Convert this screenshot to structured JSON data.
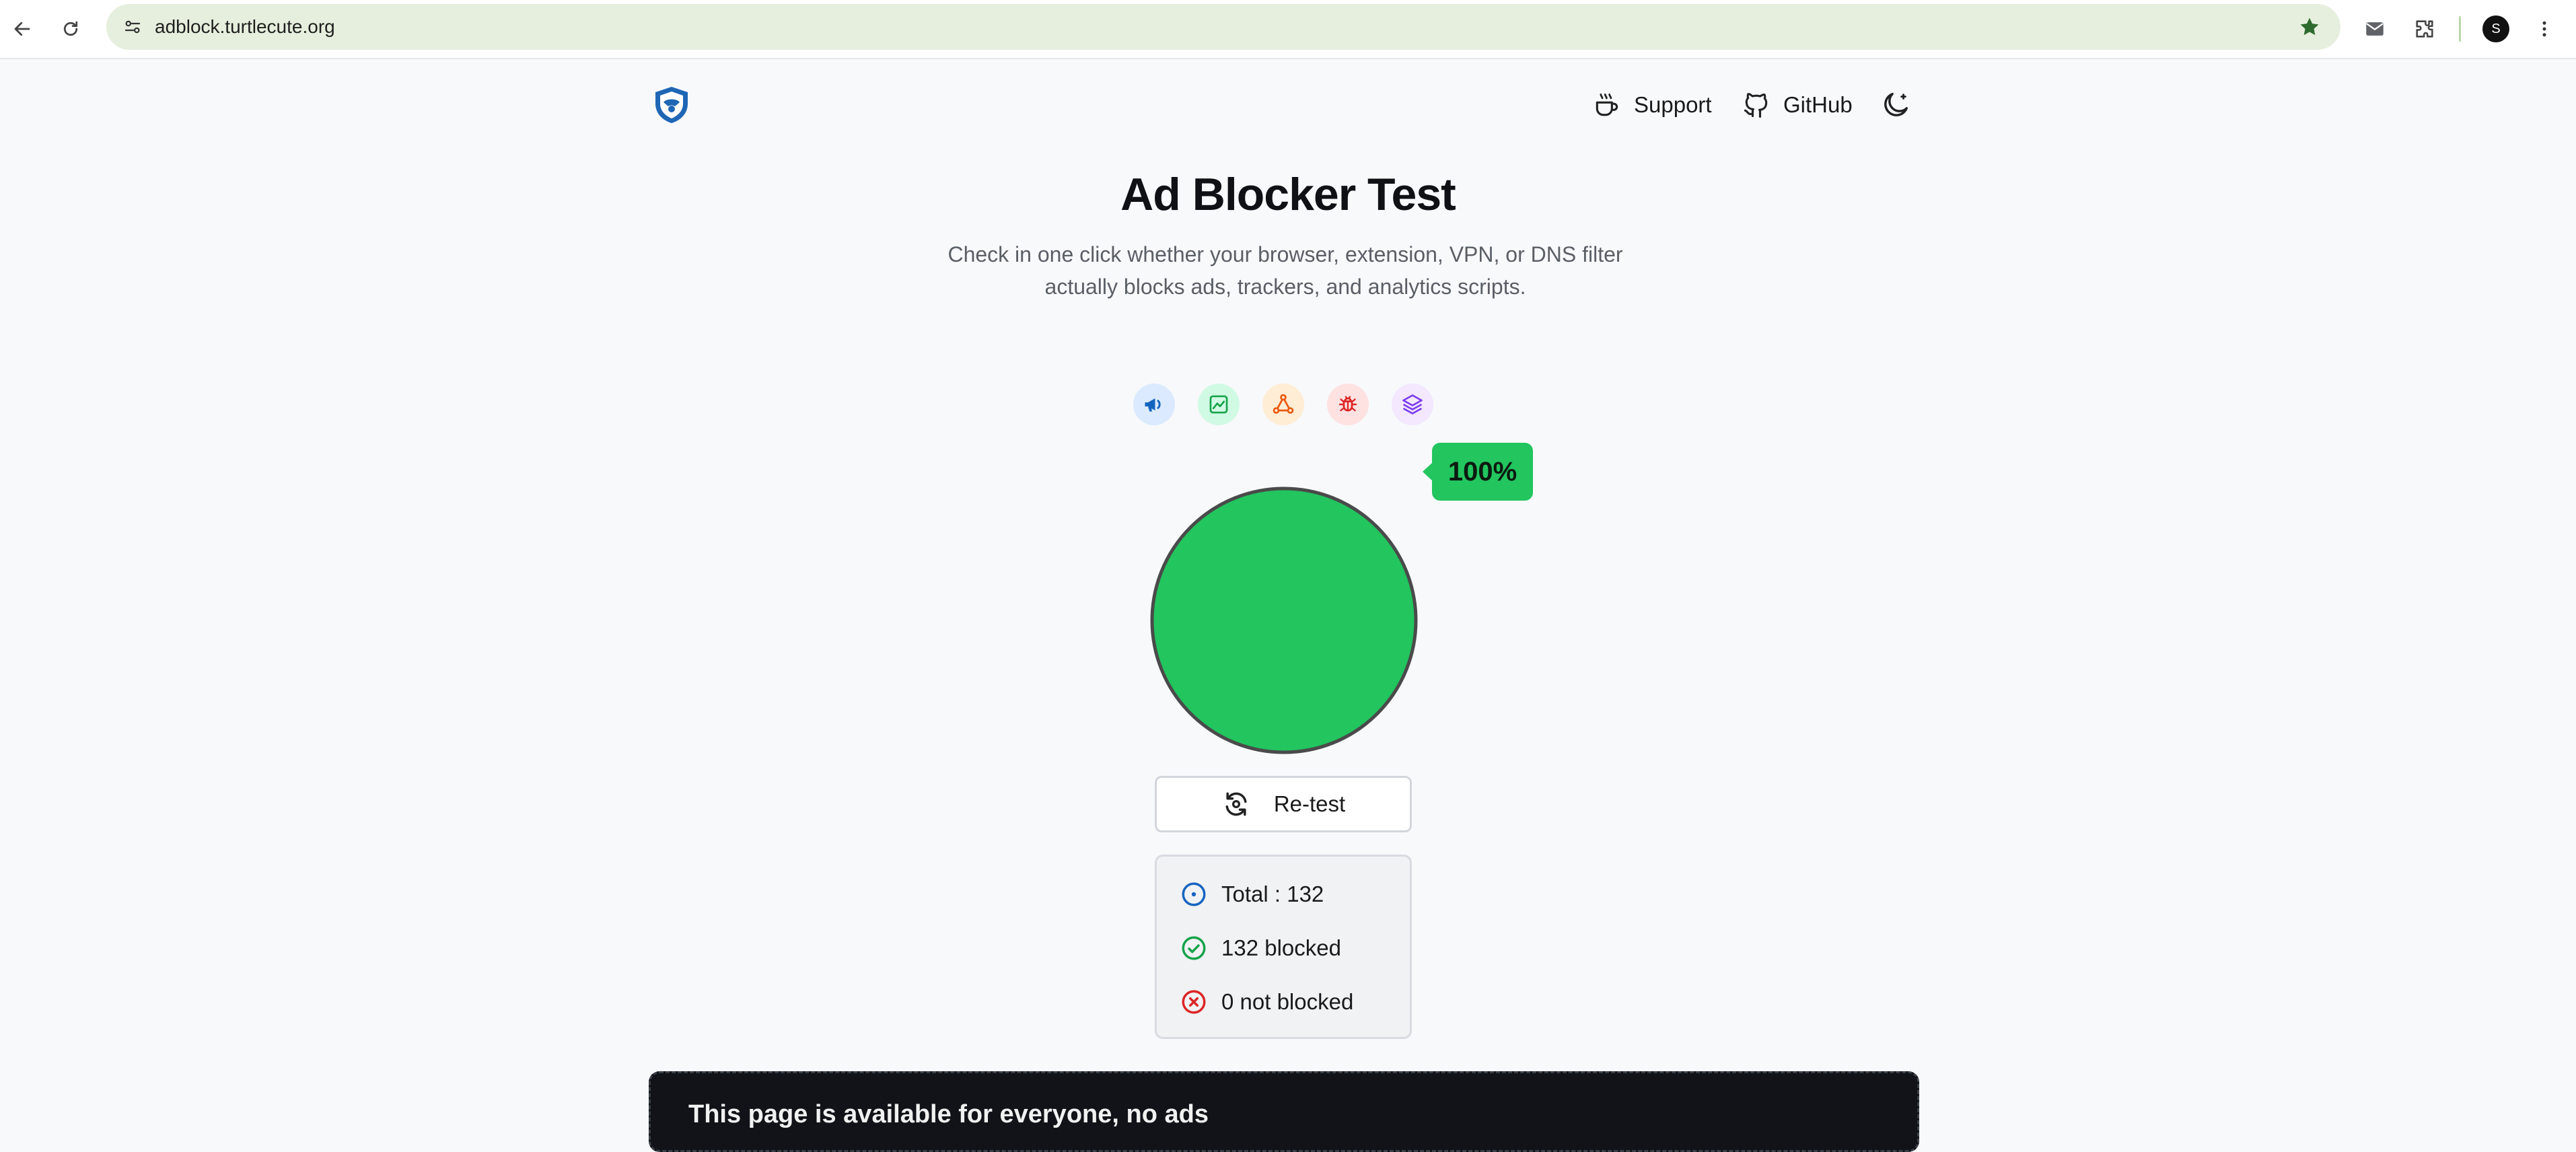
{
  "browser": {
    "url": "adblock.turtlecute.org",
    "avatar_letter": "S",
    "icons": [
      "back-icon",
      "reload-icon",
      "site-info-icon",
      "bookmark-star-icon",
      "mail-icon",
      "extensions-icon",
      "profile-avatar",
      "kebab-menu-icon"
    ]
  },
  "header": {
    "support_label": "Support",
    "github_label": "GitHub",
    "icons": [
      "shield-logo-icon",
      "coffee-icon",
      "github-icon",
      "moon-icon"
    ]
  },
  "hero": {
    "title": "Ad Blocker Test",
    "subtitle_line1": "Check in one click whether your browser, extension, VPN, or DNS filter",
    "subtitle_line2": "actually blocks ads, trackers, and analytics scripts."
  },
  "categories": [
    {
      "icon": "megaphone-icon",
      "color": "#1565c0",
      "bg": "#dbeafe"
    },
    {
      "icon": "analytics-chart-icon",
      "color": "#16a34a",
      "bg": "#d1fae5"
    },
    {
      "icon": "tracker-network-icon",
      "color": "#ea580c",
      "bg": "#ffedd5"
    },
    {
      "icon": "bug-icon",
      "color": "#dc2626",
      "bg": "#fee2e2"
    },
    {
      "icon": "layers-icon",
      "color": "#7c3aed",
      "bg": "#f3e8ff"
    }
  ],
  "result": {
    "percent_label": "100%",
    "blocked_fraction": 1.0,
    "pie_color": "#22c55e"
  },
  "retest_label": "Re-test",
  "stats": {
    "total": "Total : 132",
    "blocked": "132 blocked",
    "not_blocked": "0 not blocked",
    "colors": {
      "total": "#1565c0",
      "blocked": "#16a34a",
      "not_blocked": "#dc2626"
    }
  },
  "notice": {
    "text": "This page is available for everyone, no ads"
  }
}
